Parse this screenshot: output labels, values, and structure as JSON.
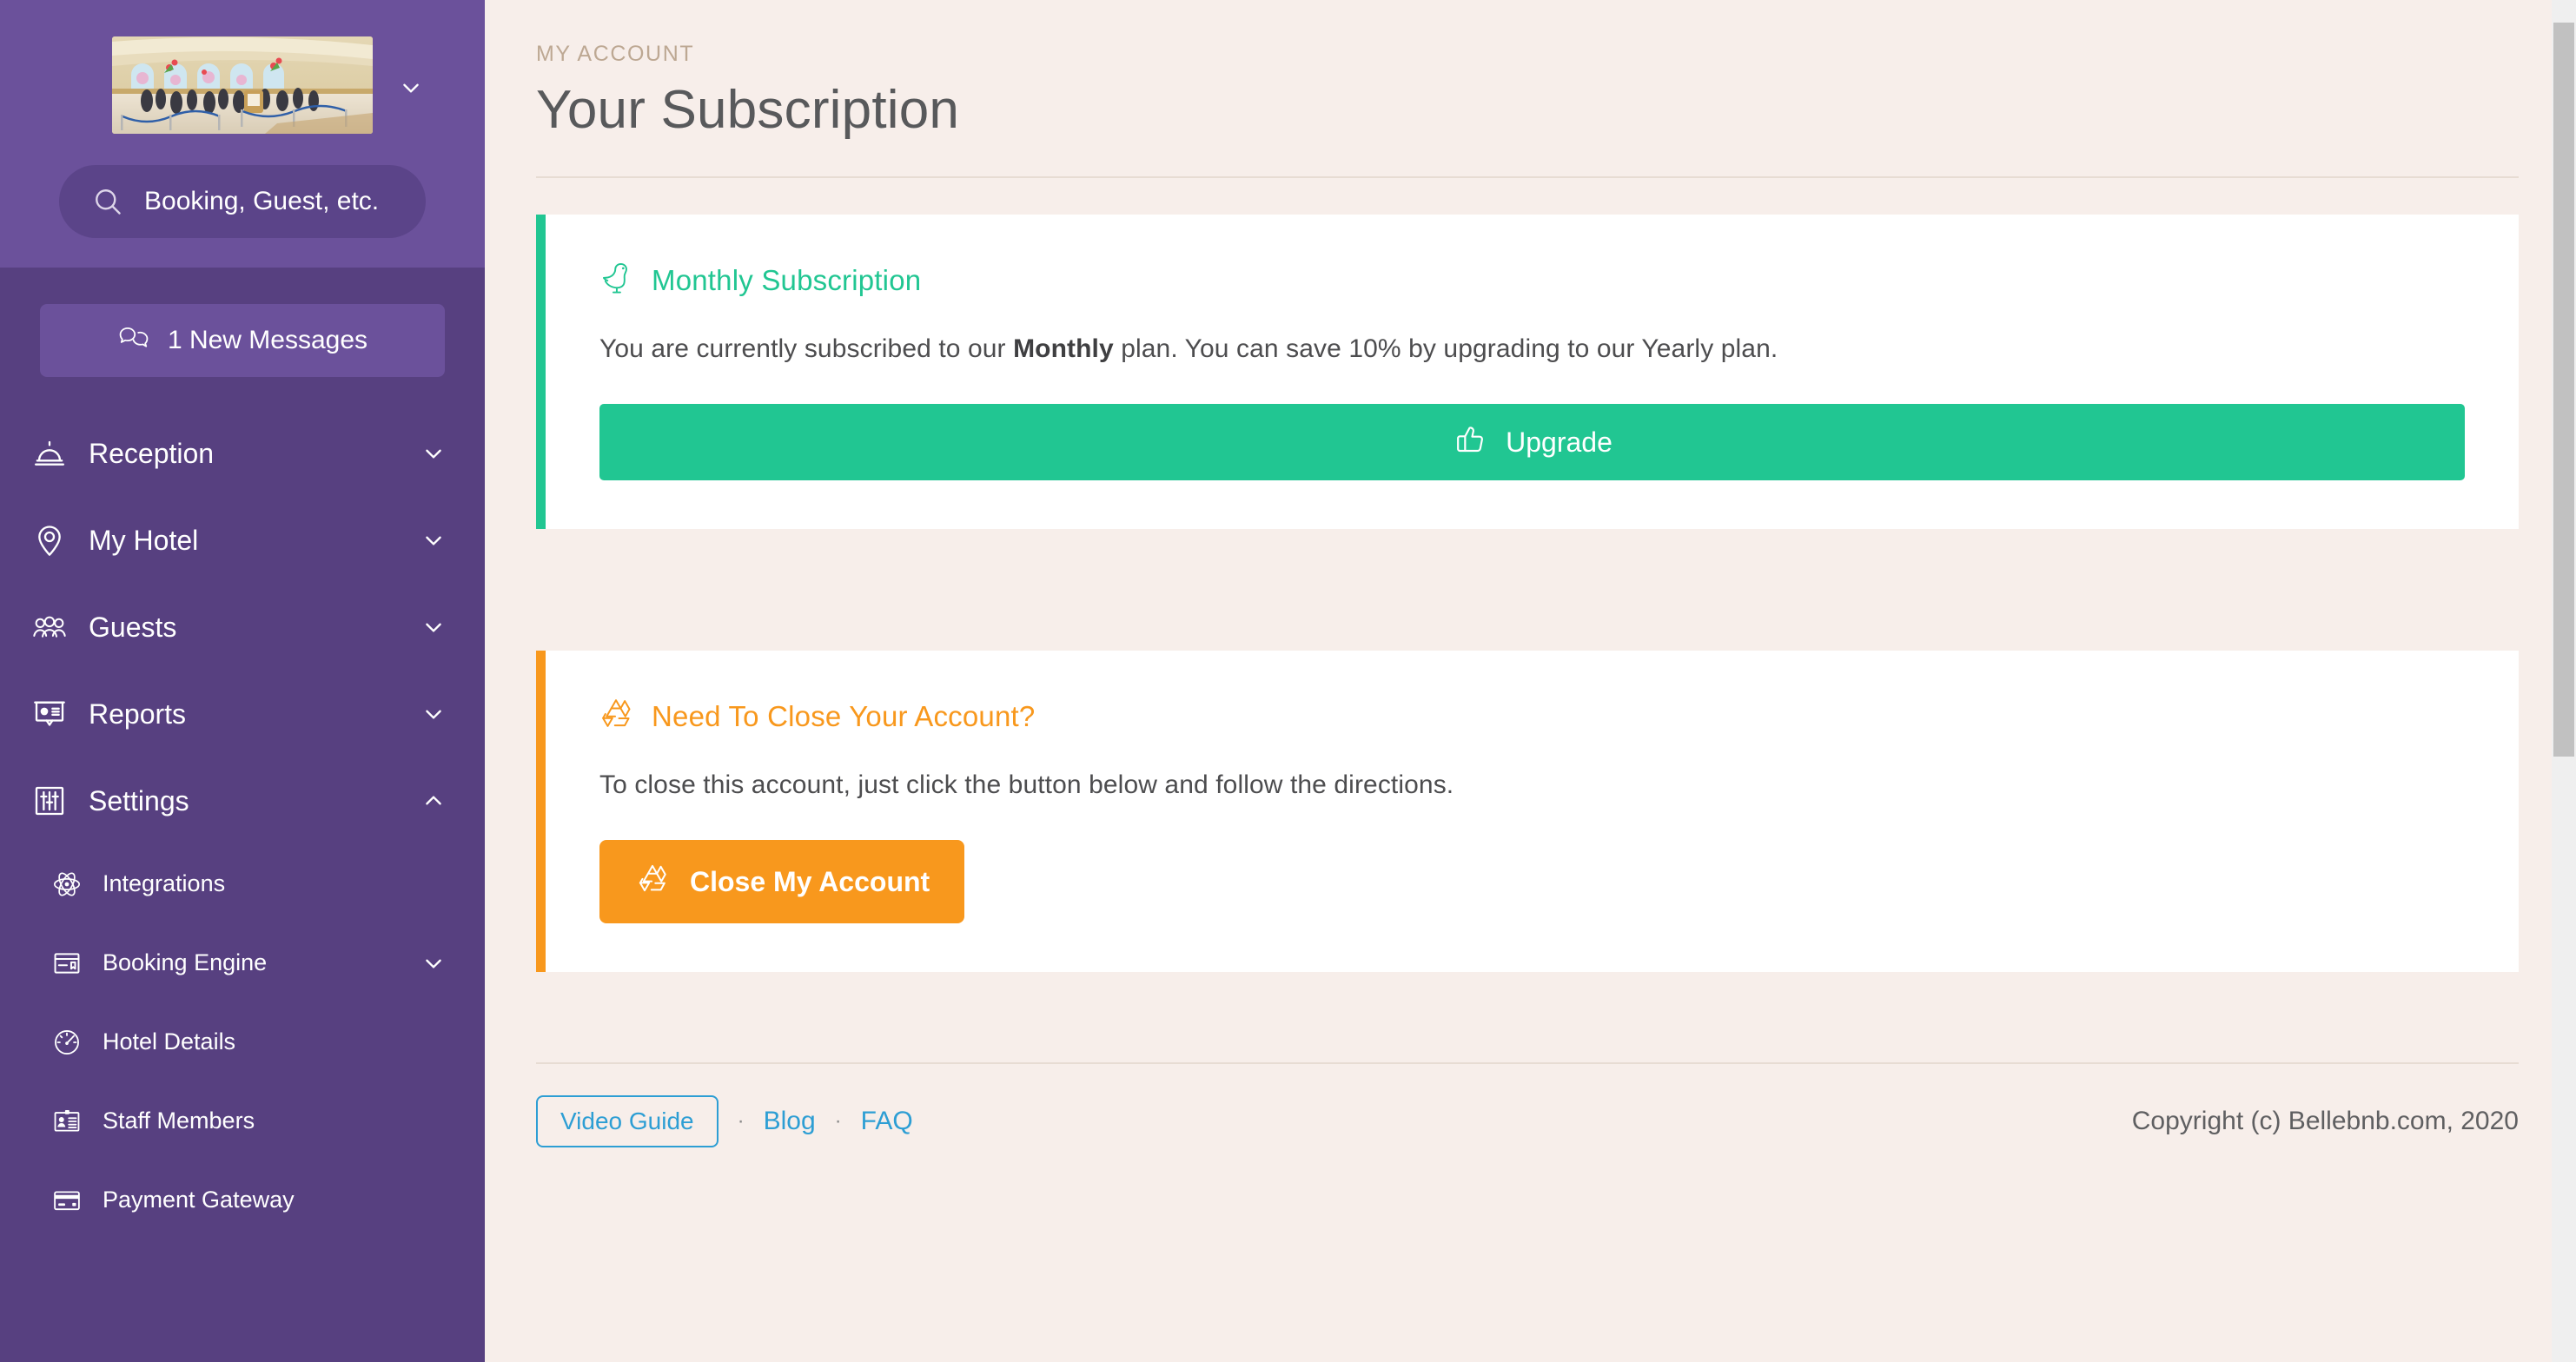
{
  "sidebar": {
    "hotel_image_alt": "hotel-lobby-photo",
    "hotel_dropdown_icon": "chevron-down-icon",
    "search": {
      "icon": "search-icon",
      "placeholder": "Booking, Guest, etc.",
      "value": ""
    },
    "messages_button": {
      "label": "1 New Messages",
      "icon": "chat-bubbles-icon"
    },
    "nav": [
      {
        "label": "Reception",
        "icon": "service-bell-icon",
        "arrow": "chevron-down-icon",
        "expanded": false
      },
      {
        "label": "My Hotel",
        "icon": "map-pin-icon",
        "arrow": "chevron-down-icon",
        "expanded": false
      },
      {
        "label": "Guests",
        "icon": "people-icon",
        "arrow": "chevron-down-icon",
        "expanded": false
      },
      {
        "label": "Reports",
        "icon": "presentation-chart-icon",
        "arrow": "chevron-down-icon",
        "expanded": false
      },
      {
        "label": "Settings",
        "icon": "sliders-icon",
        "arrow": "chevron-up-icon",
        "expanded": true
      }
    ],
    "settings_submenu": [
      {
        "label": "Integrations",
        "icon": "atom-icon",
        "arrow": null
      },
      {
        "label": "Booking Engine",
        "icon": "browser-tag-icon",
        "arrow": "chevron-down-icon"
      },
      {
        "label": "Hotel Details",
        "icon": "gauge-icon",
        "arrow": null
      },
      {
        "label": "Staff Members",
        "icon": "id-card-icon",
        "arrow": null
      },
      {
        "label": "Payment Gateway",
        "icon": "credit-card-icon",
        "arrow": null
      }
    ]
  },
  "header": {
    "eyebrow": "MY ACCOUNT",
    "title": "Your Subscription"
  },
  "subscription_card": {
    "icon": "bird-icon",
    "title": "Monthly Subscription",
    "body_before": "You are currently subscribed to our ",
    "body_bold": "Monthly",
    "body_after": " plan. You can save 10% by upgrading to our Yearly plan.",
    "button": {
      "label": "Upgrade",
      "icon": "thumbs-up-icon"
    }
  },
  "close_account_card": {
    "icon": "recycle-icon",
    "title": "Need To Close Your Account?",
    "body": "To close this account, just click the button below and follow the directions.",
    "button": {
      "label": "Close My Account",
      "icon": "recycle-icon"
    }
  },
  "footer": {
    "video_guide": "Video Guide",
    "separator_1": "·",
    "blog": "Blog",
    "separator_2": "·",
    "faq": "FAQ",
    "copyright": "Copyright (c) Bellebnb.com, 2020"
  },
  "colors": {
    "sidebar_bg": "#574080",
    "sidebar_top_bg": "#6b519b",
    "page_bg": "#f7eeea",
    "accent_green": "#21c692",
    "accent_orange": "#f8981d",
    "link_blue": "#2d9ed4",
    "title_gray": "#58595b",
    "eyebrow_tan": "#bda893"
  }
}
